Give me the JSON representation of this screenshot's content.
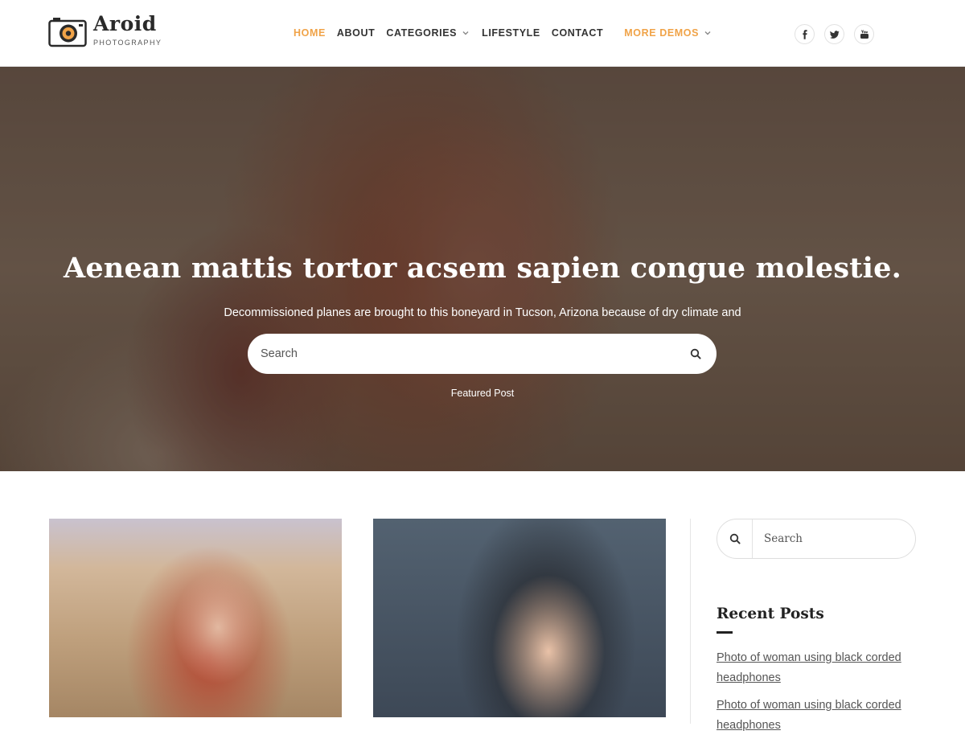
{
  "brand": {
    "name": "Aroid",
    "tagline": "PHOTOGRAPHY",
    "accent_color": "#f0a348"
  },
  "nav": {
    "items": [
      {
        "label": "HOME",
        "active": true
      },
      {
        "label": "ABOUT"
      },
      {
        "label": "CATEGORIES",
        "has_dropdown": true
      },
      {
        "label": "LIFESTYLE"
      },
      {
        "label": "CONTACT"
      }
    ],
    "more": {
      "label": "MORE DEMOS",
      "has_dropdown": true
    }
  },
  "social": {
    "icons": [
      "facebook-icon",
      "twitter-icon",
      "youtube-icon"
    ]
  },
  "hero": {
    "title": "Aenean mattis tortor acsem sapien congue molestie.",
    "subtitle": "Decommissioned planes are brought to this boneyard in Tucson, Arizona because of dry climate and",
    "search_placeholder": "Search",
    "featured_label": "Featured Post"
  },
  "sidebar": {
    "search_placeholder": "Search",
    "recent_title": "Recent Posts",
    "recent_posts": [
      "Photo of woman using black corded headphones",
      "Photo of woman using black corded headphones"
    ]
  }
}
